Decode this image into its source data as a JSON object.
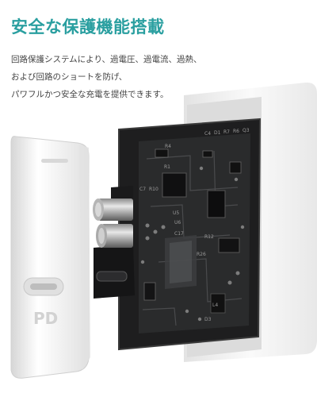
{
  "headline": "安全な保護機能搭載",
  "description": [
    "回路保護システムにより、過電圧、過電流、過熱、",
    "および回路のショートを防げ、",
    "パワフルかつ安全な充電を提供できます。"
  ],
  "product": {
    "port_label": "PD",
    "board_labels": [
      "R4",
      "R1",
      "C7",
      "R10",
      "U5",
      "C4",
      "D1",
      "R7",
      "R6",
      "Q3",
      "U6",
      "R26",
      "C17",
      "R12",
      "L4",
      "D3"
    ]
  },
  "colors": {
    "headline": "#2a9fa0",
    "text": "#444444",
    "board": "#1e1e1f",
    "casing": "#f4f4f4"
  }
}
